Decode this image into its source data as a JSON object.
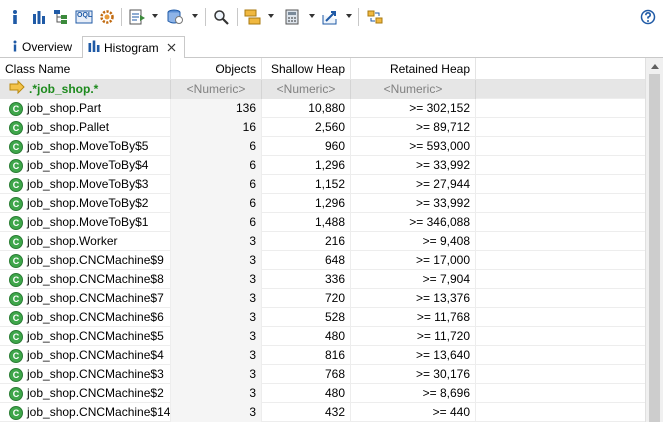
{
  "toolbar": {
    "icons": [
      "info-icon",
      "histogram-icon",
      "dominator-tree-icon",
      "oql-icon",
      "gear-icon",
      "report-icon",
      "heap-dump-icon",
      "search-icon",
      "group-icon",
      "calculator-icon",
      "export-icon",
      "compare-icon",
      "help-icon"
    ],
    "oql_label": "OQL"
  },
  "tabs": [
    {
      "label": "Overview",
      "icon": "info-icon"
    },
    {
      "label": "Histogram",
      "icon": "histogram-icon",
      "active": true
    }
  ],
  "table": {
    "columns": [
      "Class Name",
      "Objects",
      "Shallow Heap",
      "Retained Heap"
    ],
    "filter": {
      "name": ".*job_shop.*",
      "objects": "<Numeric>",
      "shallow": "<Numeric>",
      "retained": "<Numeric>"
    },
    "rows": [
      {
        "name": "job_shop.Part",
        "objects": "136",
        "shallow": "10,880",
        "retained": ">= 302,152"
      },
      {
        "name": "job_shop.Pallet",
        "objects": "16",
        "shallow": "2,560",
        "retained": ">= 89,712"
      },
      {
        "name": "job_shop.MoveToBy$5",
        "objects": "6",
        "shallow": "960",
        "retained": ">= 593,000"
      },
      {
        "name": "job_shop.MoveToBy$4",
        "objects": "6",
        "shallow": "1,296",
        "retained": ">= 33,992"
      },
      {
        "name": "job_shop.MoveToBy$3",
        "objects": "6",
        "shallow": "1,152",
        "retained": ">= 27,944"
      },
      {
        "name": "job_shop.MoveToBy$2",
        "objects": "6",
        "shallow": "1,296",
        "retained": ">= 33,992"
      },
      {
        "name": "job_shop.MoveToBy$1",
        "objects": "6",
        "shallow": "1,488",
        "retained": ">= 346,088"
      },
      {
        "name": "job_shop.Worker",
        "objects": "3",
        "shallow": "216",
        "retained": ">= 9,408"
      },
      {
        "name": "job_shop.CNCMachine$9",
        "objects": "3",
        "shallow": "648",
        "retained": ">= 17,000"
      },
      {
        "name": "job_shop.CNCMachine$8",
        "objects": "3",
        "shallow": "336",
        "retained": ">= 7,904"
      },
      {
        "name": "job_shop.CNCMachine$7",
        "objects": "3",
        "shallow": "720",
        "retained": ">= 13,376"
      },
      {
        "name": "job_shop.CNCMachine$6",
        "objects": "3",
        "shallow": "528",
        "retained": ">= 11,768"
      },
      {
        "name": "job_shop.CNCMachine$5",
        "objects": "3",
        "shallow": "480",
        "retained": ">= 11,720"
      },
      {
        "name": "job_shop.CNCMachine$4",
        "objects": "3",
        "shallow": "816",
        "retained": ">= 13,640"
      },
      {
        "name": "job_shop.CNCMachine$3",
        "objects": "3",
        "shallow": "768",
        "retained": ">= 30,176"
      },
      {
        "name": "job_shop.CNCMachine$2",
        "objects": "3",
        "shallow": "480",
        "retained": ">= 8,696"
      },
      {
        "name": "job_shop.CNCMachine$14",
        "objects": "3",
        "shallow": "432",
        "retained": ">= 440"
      }
    ]
  },
  "colors": {
    "class_icon": "#3ea64a",
    "filter_text": "#1d8a1d",
    "toolbar_blue": "#1f5aa6"
  }
}
